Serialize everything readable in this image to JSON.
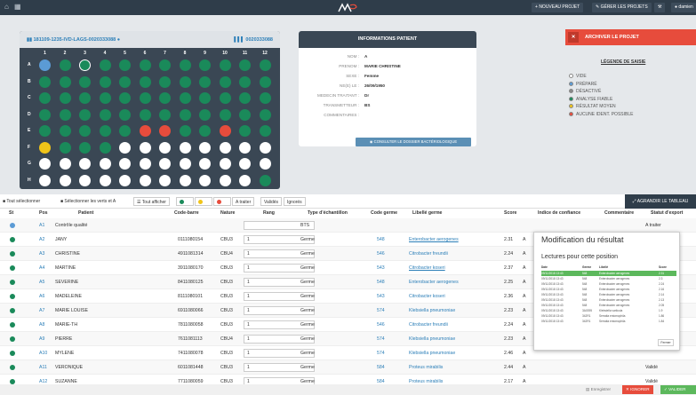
{
  "topbar": {
    "nouveau": "NOUVEAU PROJET",
    "gerer": "GÉRER LES PROJETS",
    "user": "damien"
  },
  "plate": {
    "title": "181109-1235-IVD-LAGS-0020333088",
    "code": "0020333088",
    "columns": [
      "1",
      "2",
      "3",
      "4",
      "5",
      "6",
      "7",
      "8",
      "9",
      "10",
      "11",
      "12"
    ],
    "rows": [
      "A",
      "B",
      "C",
      "D",
      "E",
      "F",
      "G",
      "H"
    ]
  },
  "patient": {
    "title": "INFORMATIONS PATIENT",
    "fields": [
      {
        "label": "NOM :",
        "value": "A"
      },
      {
        "label": "PRENOM :",
        "value": "MARIE CHRISTINE"
      },
      {
        "label": "SEXE :",
        "value": "Femme"
      },
      {
        "label": "NE(E) LE :",
        "value": "26/09/1950"
      },
      {
        "label": "MEDECIN TRAITANT :",
        "value": "Dr"
      },
      {
        "label": "TRANSMETTEUR :",
        "value": "BS"
      },
      {
        "label": "COMMENTAIRES :",
        "value": ""
      }
    ],
    "consult": "CONSULTER LE DOSSIER BACTÉRIOLOGIQUE"
  },
  "archive": {
    "label": "ARCHIVER LE PROJET"
  },
  "legend": {
    "title": "LÉGENDE DE SAISIE",
    "items": [
      {
        "label": "VIDE",
        "color": "#ffffff"
      },
      {
        "label": "PRÉPARÉ",
        "color": "#5b9bd5"
      },
      {
        "label": "DÉSACTIVÉ",
        "color": "#888888"
      },
      {
        "label": "ANALYSE FIABLE",
        "color": "#1a8a5a"
      },
      {
        "label": "RÉSULTAT MOYEN",
        "color": "#f0c419"
      },
      {
        "label": "AUCUNE IDENT. POSSIBLE",
        "color": "#e74c3c"
      }
    ]
  },
  "toolbar": {
    "tout_selectionner": "Tout sélectionner",
    "selectionner_verts": "Sélectionner les verts et A",
    "tout_afficher": "Tout afficher",
    "a_traiter": "A traiter",
    "valides": "Validés",
    "ignores": "Ignorés",
    "agrandir": "AGRANDIR LE TABLEAU"
  },
  "table": {
    "headers": [
      "St",
      "Pos",
      "Patient",
      "Code-barre",
      "Nature",
      "Rang",
      "Type d'échantillon",
      "Code germe",
      "Libellé germe",
      "Score",
      "Indice de confiance",
      "Commentaire",
      "Statut d'export"
    ],
    "rows": [
      {
        "pos": "A1",
        "patient": "Contrôle qualité",
        "code": "",
        "nature": "",
        "rang": "",
        "type": "BTS",
        "germe": "",
        "libelle": "",
        "score": "",
        "indice": "",
        "statut": "A traiter",
        "dot": "#5b9bd5"
      },
      {
        "pos": "A2",
        "patient": "JANY",
        "code": "0111080154",
        "nature": "CBU3",
        "rang": "1",
        "type": "Germe",
        "germe": "548",
        "libelle": "Enterobacter aerogenes",
        "score": "2.31",
        "indice": "A",
        "statut": "",
        "dot": "#1a8a5a"
      },
      {
        "pos": "A3",
        "patient": "CHRISTINE",
        "code": "4911081314",
        "nature": "CBU4",
        "rang": "1",
        "type": "Germe",
        "germe": "546",
        "libelle": "Citrobacter freundii",
        "score": "2.24",
        "indice": "A",
        "statut": "",
        "dot": "#1a8a5a"
      },
      {
        "pos": "A4",
        "patient": "MARTINE",
        "code": "3911080170",
        "nature": "CBU3",
        "rang": "1",
        "type": "Germe",
        "germe": "543",
        "libelle": "Citrobacter koseri",
        "score": "2.37",
        "indice": "A",
        "statut": "",
        "dot": "#1a8a5a"
      },
      {
        "pos": "A5",
        "patient": "SEVERINE",
        "code": "8411080125",
        "nature": "CBU3",
        "rang": "1",
        "type": "Germe",
        "germe": "548",
        "libelle": "Enterobacter aerogenes",
        "score": "2.25",
        "indice": "A",
        "statut": "",
        "dot": "#1a8a5a"
      },
      {
        "pos": "A6",
        "patient": "MADELEINE",
        "code": "8111080101",
        "nature": "CBU3",
        "rang": "1",
        "type": "Germe",
        "germe": "543",
        "libelle": "Citrobacter koseri",
        "score": "2.36",
        "indice": "A",
        "statut": "",
        "dot": "#1a8a5a"
      },
      {
        "pos": "A7",
        "patient": "MARIE LOUISE",
        "code": "6911080066",
        "nature": "CBU3",
        "rang": "1",
        "type": "Germe",
        "germe": "574",
        "libelle": "Klebsiella pneumoniae",
        "score": "2.23",
        "indice": "A",
        "statut": "",
        "dot": "#1a8a5a"
      },
      {
        "pos": "A8",
        "patient": "MARIE-TH",
        "code": "7811080058",
        "nature": "CBU3",
        "rang": "1",
        "type": "Germe",
        "germe": "546",
        "libelle": "Citrobacter freundii",
        "score": "2.24",
        "indice": "A",
        "statut": "",
        "dot": "#1a8a5a"
      },
      {
        "pos": "A9",
        "patient": "PIERRE",
        "code": "7611081113",
        "nature": "CBU4",
        "rang": "1",
        "type": "Germe",
        "germe": "574",
        "libelle": "Klebsiella pneumoniae",
        "score": "2.23",
        "indice": "A",
        "statut": "",
        "dot": "#1a8a5a"
      },
      {
        "pos": "A10",
        "patient": "MYLENE",
        "code": "7411080078",
        "nature": "CBU3",
        "rang": "1",
        "type": "Germe",
        "germe": "574",
        "libelle": "Klebsiella pneumoniae",
        "score": "2.46",
        "indice": "A",
        "statut": "",
        "dot": "#1a8a5a"
      },
      {
        "pos": "A11",
        "patient": "VERONIQUE",
        "code": "6011081448",
        "nature": "CBU3",
        "rang": "1",
        "type": "Germe",
        "germe": "584",
        "libelle": "Proteus mirabilis",
        "score": "2.44",
        "indice": "A",
        "statut": "Validé",
        "dot": "#1a8a5a"
      },
      {
        "pos": "A12",
        "patient": "SUZANNE",
        "code": "7711080059",
        "nature": "CBU3",
        "rang": "1",
        "type": "Germe",
        "germe": "584",
        "libelle": "Proteus mirabilis",
        "score": "2.17",
        "indice": "A",
        "statut": "Validé",
        "dot": "#1a8a5a"
      }
    ]
  },
  "modal": {
    "title": "Modification du résultat",
    "subtitle": "Lectures pour cette position",
    "headers": [
      "Date",
      "Germe",
      "Libellé",
      "Score"
    ],
    "rows": [
      {
        "date": "09/11/2018 13:43",
        "germe": "548",
        "libelle": "Enterobacter aerogenes",
        "score": "2.31"
      },
      {
        "date": "09/11/2018 13:43",
        "germe": "548",
        "libelle": "Enterobacter aerogenes",
        "score": "2.3"
      },
      {
        "date": "09/11/2018 13:43",
        "germe": "548",
        "libelle": "Enterobacter aerogenes",
        "score": "2.24"
      },
      {
        "date": "09/11/2018 13:43",
        "germe": "548",
        "libelle": "Enterobacter aerogenes",
        "score": "2.16"
      },
      {
        "date": "09/11/2018 13:43",
        "germe": "548",
        "libelle": "Enterobacter aerogenes",
        "score": "2.14"
      },
      {
        "date": "09/11/2018 13:43",
        "germe": "548",
        "libelle": "Enterobacter aerogenes",
        "score": "2.13"
      },
      {
        "date": "09/11/2018 13:43",
        "germe": "548",
        "libelle": "Enterobacter aerogenes",
        "score": "2.05"
      },
      {
        "date": "09/11/2018 13:43",
        "germe": "3A0395",
        "libelle": "Klebsiella variicola",
        "score": "1.9"
      },
      {
        "date": "09/11/2018 13:43",
        "germe": "342R1",
        "libelle": "Serratia entomophila",
        "score": "1.86"
      },
      {
        "date": "09/11/2018 13:43",
        "germe": "342R1",
        "libelle": "Serratia entomophila",
        "score": "1.84"
      }
    ],
    "close": "Fermer"
  },
  "footer": {
    "enregistrer": "Enregistrer",
    "ignorer": "IGNORER",
    "valider": "VALIDER"
  }
}
